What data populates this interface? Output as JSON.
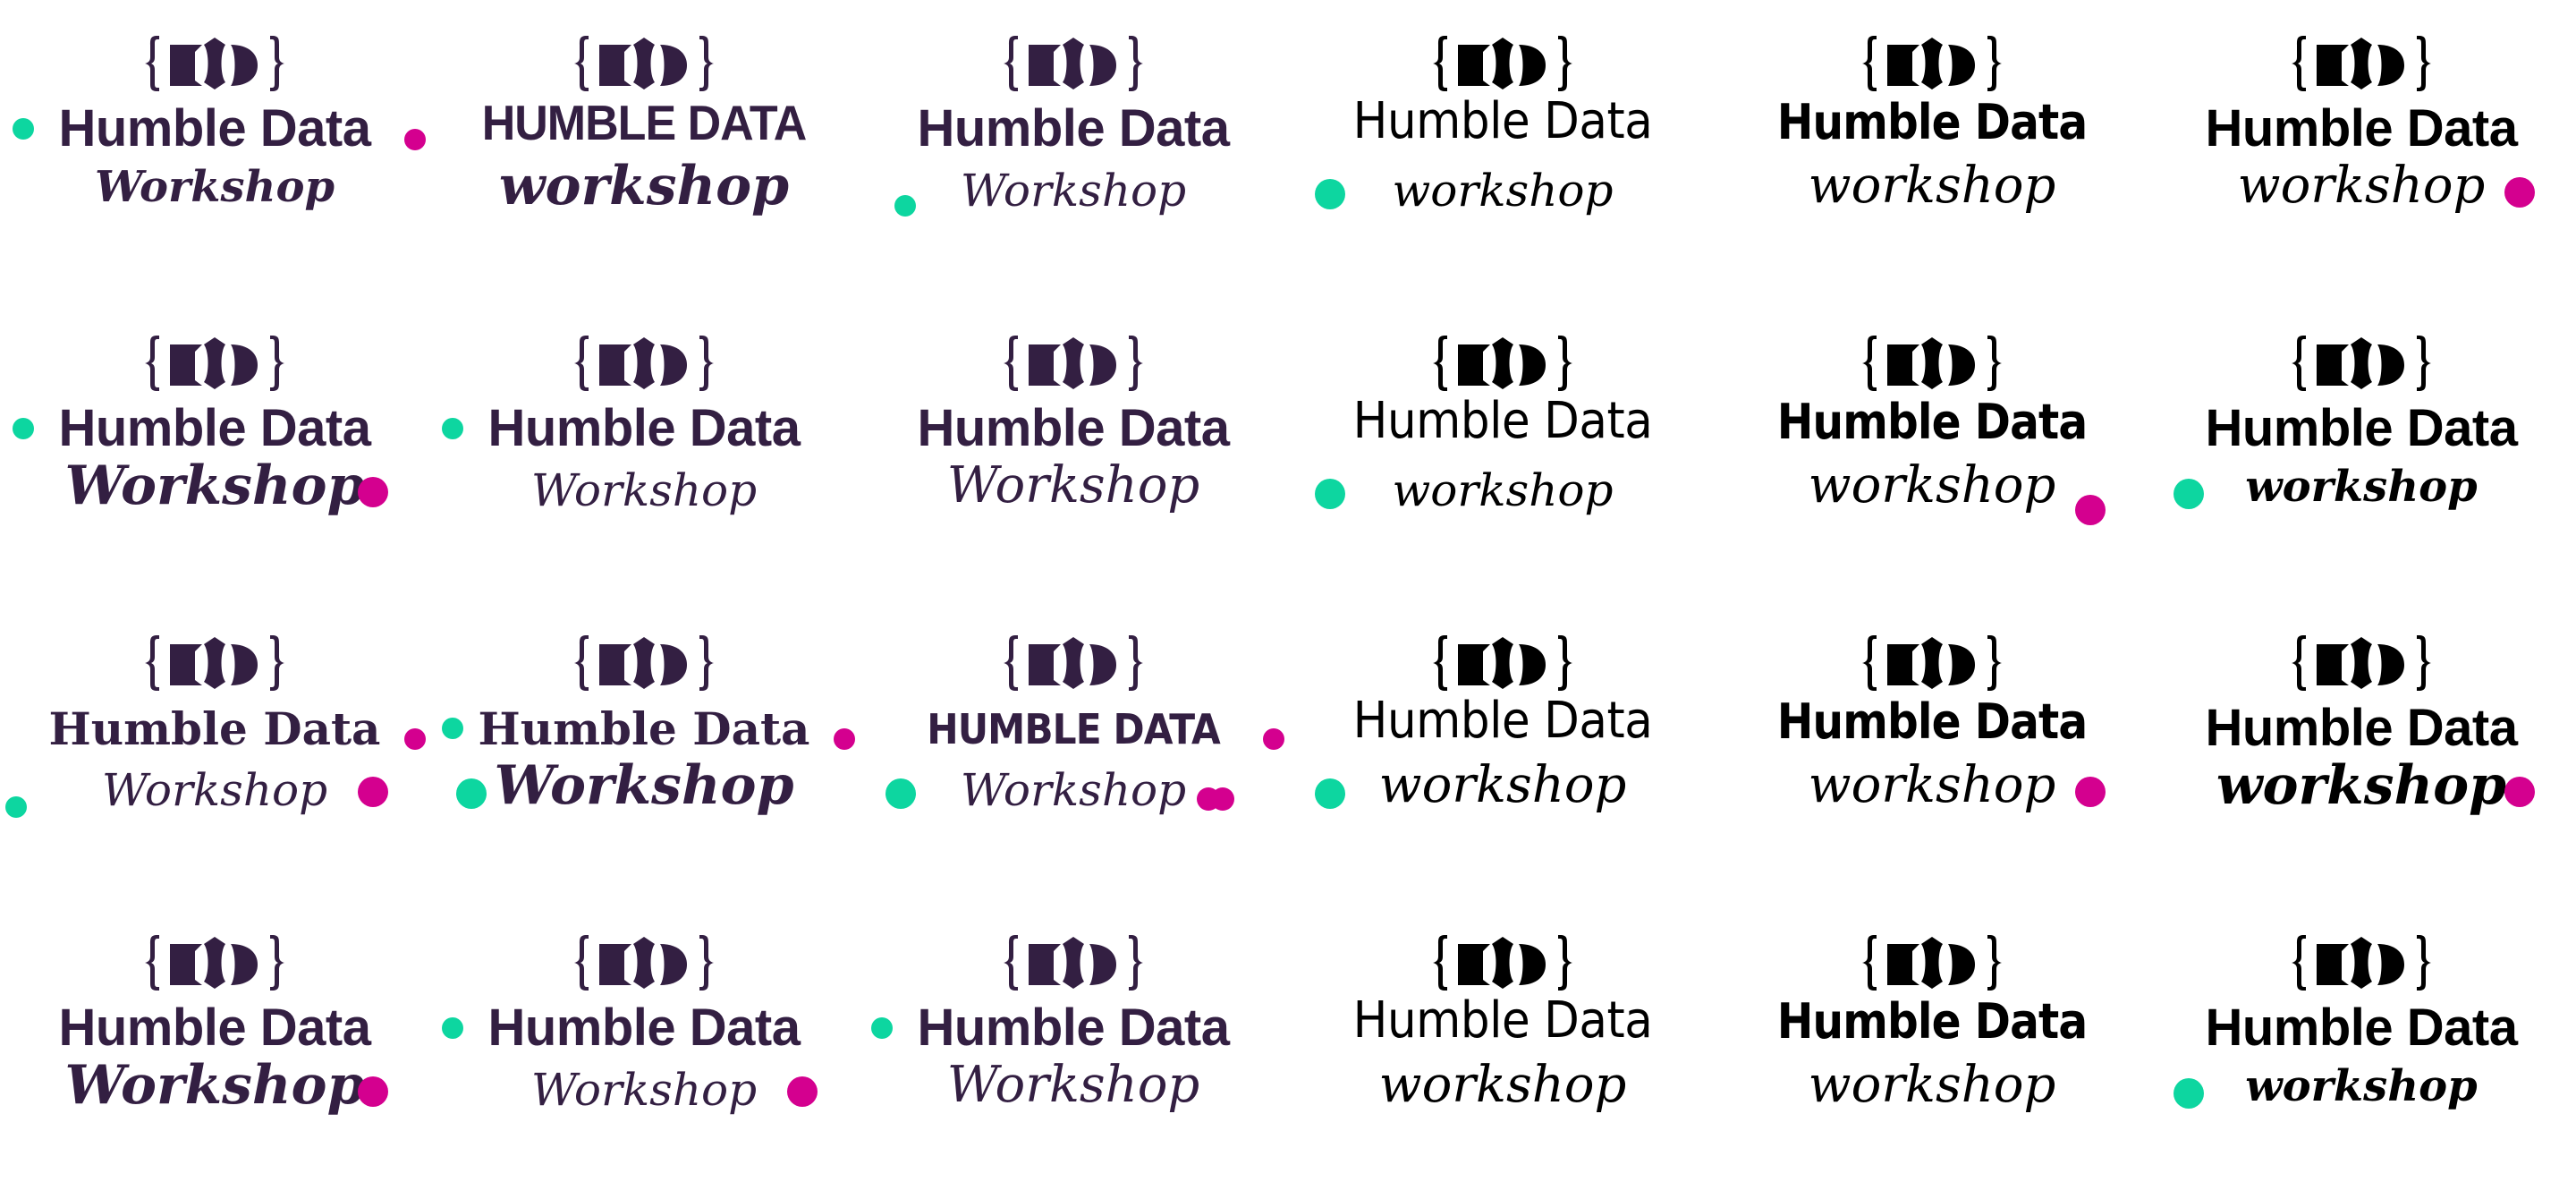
{
  "sheet": {
    "title_text": "Humble Data",
    "title_caps_text": "HUMBLE DATA",
    "subtitle_capital": "Workshop",
    "subtitle_lower": "workshop",
    "icon": "humble-data-brace-logo-icon",
    "colors": {
      "purple": "#331f42",
      "black": "#000000",
      "teal": "#0dd6a0",
      "magenta": "#d4008f",
      "background": "#ffffff"
    }
  },
  "variants": [
    {
      "row": 1,
      "col": 1,
      "theme": "purple",
      "title": "Humble Data",
      "title_style": "bold",
      "subtitle": "Workshop",
      "subtitle_style": "brush",
      "dots": [
        "teal-before-title",
        "magenta-after-title"
      ]
    },
    {
      "row": 1,
      "col": 2,
      "theme": "purple",
      "title": "HUMBLE DATA",
      "title_style": "caps",
      "subtitle": "workshop",
      "subtitle_style": "bold",
      "dots": []
    },
    {
      "row": 1,
      "col": 3,
      "theme": "purple",
      "title": "Humble Data",
      "title_style": "bold",
      "subtitle": "Workshop",
      "subtitle_style": "thin",
      "dots": [
        "teal-lower-left"
      ]
    },
    {
      "row": 1,
      "col": 4,
      "theme": "black",
      "title": "Humble Data",
      "title_style": "light",
      "subtitle": "workshop",
      "subtitle_style": "thin",
      "dots": [
        "teal-before-subtitle"
      ]
    },
    {
      "row": 1,
      "col": 5,
      "theme": "black",
      "title": "Humble Data",
      "title_style": "medium",
      "subtitle": "workshop",
      "subtitle_style": "script",
      "dots": []
    },
    {
      "row": 1,
      "col": 6,
      "theme": "black",
      "title": "Humble Data",
      "title_style": "bold",
      "subtitle": "workshop",
      "subtitle_style": "script",
      "dots": [
        "magenta-after-subtitle"
      ]
    },
    {
      "row": 2,
      "col": 1,
      "theme": "purple",
      "title": "Humble Data",
      "title_style": "bold",
      "subtitle": "Workshop",
      "subtitle_style": "bold",
      "dots": [
        "teal-before-title",
        "magenta-after-subtitle"
      ]
    },
    {
      "row": 2,
      "col": 2,
      "theme": "purple",
      "title": "Humble Data",
      "title_style": "bold",
      "subtitle": "Workshop",
      "subtitle_style": "thin",
      "dots": [
        "teal-before-title"
      ]
    },
    {
      "row": 2,
      "col": 3,
      "theme": "purple",
      "title": "Humble Data",
      "title_style": "bold",
      "subtitle": "Workshop",
      "subtitle_style": "script",
      "dots": []
    },
    {
      "row": 2,
      "col": 4,
      "theme": "black",
      "title": "Humble Data",
      "title_style": "light",
      "subtitle": "workshop",
      "subtitle_style": "thin",
      "dots": [
        "teal-before-subtitle"
      ]
    },
    {
      "row": 2,
      "col": 5,
      "theme": "black",
      "title": "Humble Data",
      "title_style": "medium",
      "subtitle": "workshop",
      "subtitle_style": "script",
      "dots": [
        "magenta-lower-right"
      ]
    },
    {
      "row": 2,
      "col": 6,
      "theme": "black",
      "title": "Humble Data",
      "title_style": "bold",
      "subtitle": "workshop",
      "subtitle_style": "brush",
      "dots": [
        "teal-before-subtitle"
      ]
    },
    {
      "row": 3,
      "col": 1,
      "theme": "purple",
      "title": "Humble Data",
      "title_style": "slab",
      "subtitle": "Workshop",
      "subtitle_style": "thin",
      "dots": [
        "magenta-after-title",
        "teal-far-left-subtitle",
        "magenta-after-subtitle"
      ]
    },
    {
      "row": 3,
      "col": 2,
      "theme": "purple",
      "title": "Humble Data",
      "title_style": "slab",
      "subtitle": "Workshop",
      "subtitle_style": "bold",
      "dots": [
        "teal-before-title",
        "magenta-after-title",
        "teal-before-subtitle"
      ]
    },
    {
      "row": 3,
      "col": 3,
      "theme": "purple",
      "title": "HUMBLE DATA",
      "title_style": "stencil",
      "subtitle": "Workshop",
      "subtitle_style": "thin",
      "dots": [
        "magenta-after-title",
        "teal-before-subtitle",
        "magenta-double-after-subtitle"
      ]
    },
    {
      "row": 3,
      "col": 4,
      "theme": "black",
      "title": "Humble Data",
      "title_style": "light",
      "subtitle": "workshop",
      "subtitle_style": "script",
      "dots": [
        "teal-before-subtitle"
      ]
    },
    {
      "row": 3,
      "col": 5,
      "theme": "black",
      "title": "Humble Data",
      "title_style": "medium",
      "subtitle": "workshop",
      "subtitle_style": "script",
      "dots": [
        "magenta-after-subtitle"
      ]
    },
    {
      "row": 3,
      "col": 6,
      "theme": "black",
      "title": "Humble Data",
      "title_style": "bold",
      "subtitle": "workshop",
      "subtitle_style": "bold",
      "dots": [
        "magenta-after-subtitle"
      ]
    },
    {
      "row": 4,
      "col": 1,
      "theme": "purple",
      "title": "Humble Data",
      "title_style": "bold",
      "subtitle": "Workshop",
      "subtitle_style": "bold",
      "dots": [
        "magenta-after-subtitle"
      ]
    },
    {
      "row": 4,
      "col": 2,
      "theme": "purple",
      "title": "Humble Data",
      "title_style": "bold",
      "subtitle": "Workshop",
      "subtitle_style": "thin",
      "dots": [
        "teal-before-title",
        "magenta-after-subtitle"
      ]
    },
    {
      "row": 4,
      "col": 3,
      "theme": "purple",
      "title": "Humble Data",
      "title_style": "bold",
      "subtitle": "Workshop",
      "subtitle_style": "script",
      "dots": [
        "teal-before-title"
      ]
    },
    {
      "row": 4,
      "col": 4,
      "theme": "black",
      "title": "Humble Data",
      "title_style": "light",
      "subtitle": "workshop",
      "subtitle_style": "script",
      "dots": []
    },
    {
      "row": 4,
      "col": 5,
      "theme": "black",
      "title": "Humble Data",
      "title_style": "medium",
      "subtitle": "workshop",
      "subtitle_style": "script",
      "dots": []
    },
    {
      "row": 4,
      "col": 6,
      "theme": "black",
      "title": "Humble Data",
      "title_style": "bold",
      "subtitle": "workshop",
      "subtitle_style": "brush",
      "dots": [
        "teal-before-subtitle"
      ]
    }
  ]
}
